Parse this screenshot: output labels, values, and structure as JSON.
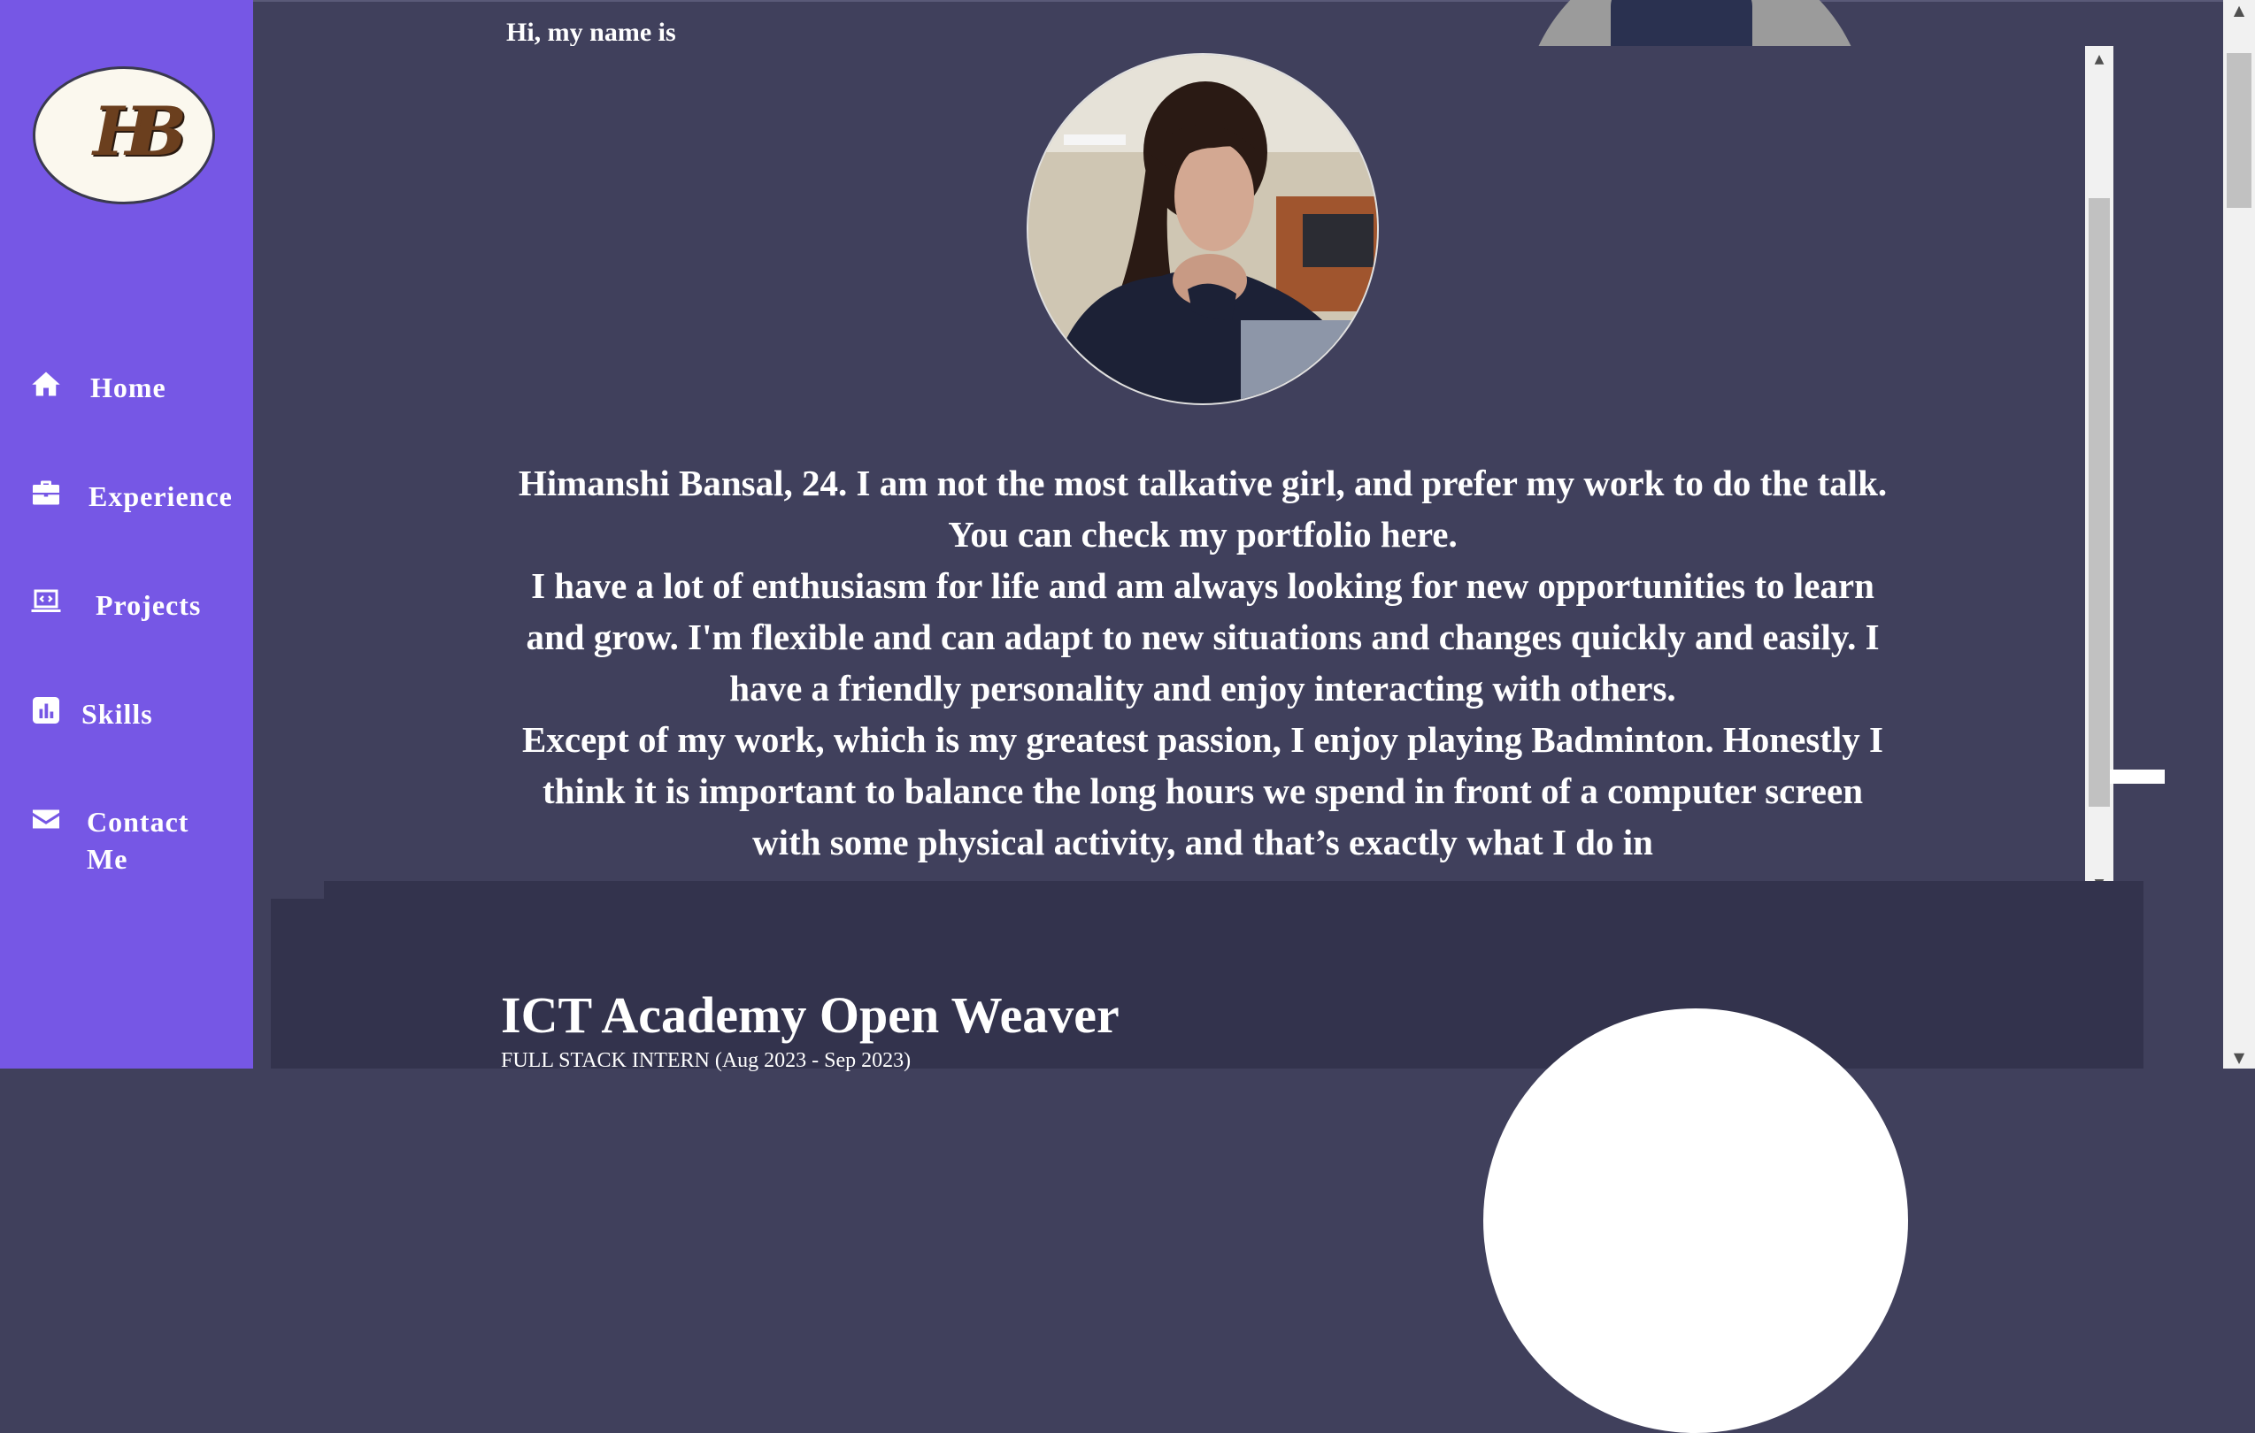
{
  "sidebar": {
    "logo_text": "HB",
    "items": [
      {
        "label": "Home",
        "icon": "home-icon"
      },
      {
        "label": "Experience",
        "icon": "briefcase-icon"
      },
      {
        "label": "Projects",
        "icon": "laptop-code-icon"
      },
      {
        "label": "Skills",
        "icon": "chart-bar-icon"
      },
      {
        "label": "Contact Me",
        "icon": "envelope-icon"
      }
    ]
  },
  "hero": {
    "greeting": "Hi, my name is"
  },
  "about": {
    "paragraphs": [
      "Himanshi Bansal, 24. I am not the most talkative girl, and prefer my work to do the talk. You can check my portfolio here.",
      "I have a lot of enthusiasm for life and am always looking for new opportunities to learn and grow. I'm flexible and can adapt to new situations and changes quickly and easily. I have a friendly personality and enjoy interacting with others.",
      "Except of my work, which is my greatest passion, I enjoy playing Badminton. Honestly I think it is important to balance the long hours we spend in front of a computer screen with some physical activity, and that’s exactly what I do in"
    ]
  },
  "experience": {
    "title": "ICT Academy Open Weaver",
    "subtitle": "FULL STACK INTERN (Aug 2023 - Sep 2023)"
  },
  "colors": {
    "sidebar": "#7657e5",
    "main_bg": "#40405c",
    "section_bg": "#33334d",
    "text": "#ffffff"
  }
}
